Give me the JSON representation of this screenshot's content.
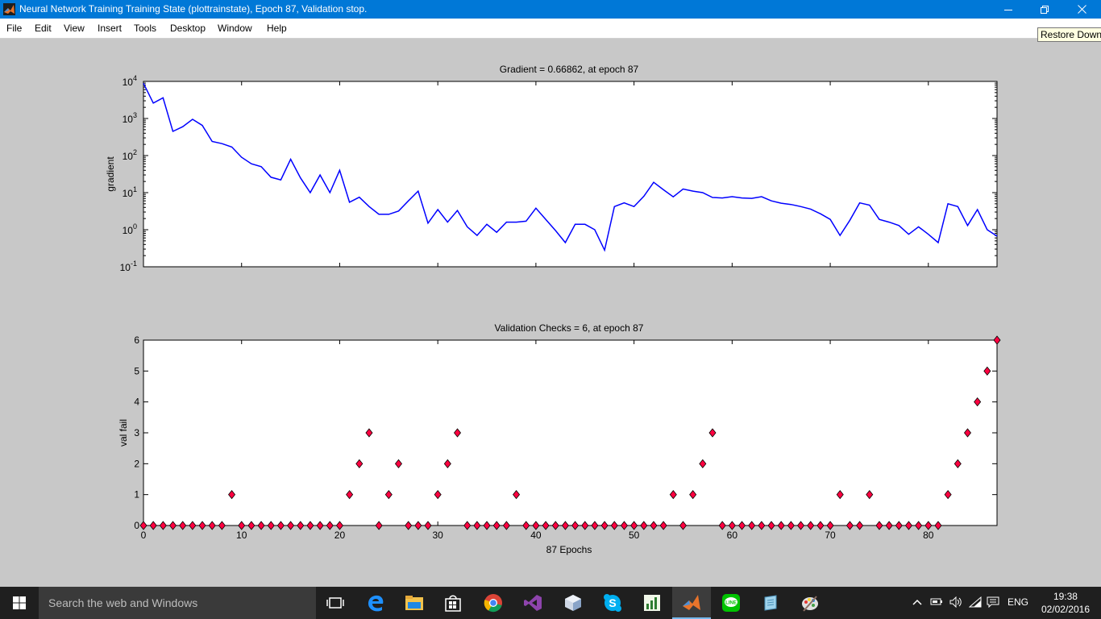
{
  "window": {
    "title": "Neural Network Training Training State (plottrainstate), Epoch 87, Validation stop.",
    "minimize_icon": "minimize-icon",
    "restore_icon": "restore-icon",
    "close_icon": "close-icon",
    "accent": "#0078d7"
  },
  "menu": [
    "File",
    "Edit",
    "View",
    "Insert",
    "Tools",
    "Desktop",
    "Window",
    "Help"
  ],
  "tooltip": "Restore Down",
  "chart_data": [
    {
      "type": "line",
      "title": "Gradient = 0.66862, at epoch 87",
      "xlabel": "",
      "ylabel": "gradient",
      "yscale": "log",
      "xlim": [
        0,
        87
      ],
      "ylim": [
        0.1,
        10000
      ],
      "x_ticks": [
        0,
        10,
        20,
        30,
        40,
        50,
        60,
        70,
        80
      ],
      "y_ticks": [
        {
          "base": "10",
          "exp": "4"
        },
        {
          "base": "10",
          "exp": "3"
        },
        {
          "base": "10",
          "exp": "2"
        },
        {
          "base": "10",
          "exp": "1"
        },
        {
          "base": "10",
          "exp": "0"
        },
        {
          "base": "10",
          "exp": "-1"
        }
      ],
      "line_color": "#0000ff",
      "series": [
        {
          "values": [
            8900,
            2600,
            3600,
            450,
            600,
            950,
            650,
            240,
            210,
            170,
            90,
            60,
            50,
            26,
            22,
            80,
            25,
            10,
            30,
            10,
            40,
            5.5,
            7.5,
            4.2,
            2.6,
            2.6,
            3.2,
            6,
            11,
            1.5,
            3.5,
            1.6,
            3.3,
            1.2,
            0.7,
            1.4,
            0.85,
            1.6,
            1.6,
            1.7,
            3.8,
            1.9,
            0.95,
            0.45,
            1.4,
            1.4,
            1.0,
            0.28,
            4.2,
            5.3,
            4.2,
            8,
            19,
            12,
            7.7,
            12.5,
            11,
            10,
            7.4,
            7.2,
            7.8,
            7.2,
            7.0,
            7.8,
            6,
            5.2,
            4.8,
            4.2,
            3.6,
            2.7,
            1.9,
            0.7,
            1.8,
            5.3,
            4.6,
            1.9,
            1.6,
            1.3,
            0.75,
            1.2,
            0.75,
            0.45,
            5,
            4.2,
            1.3,
            3.5,
            1.0,
            0.67
          ]
        }
      ]
    },
    {
      "type": "scatter",
      "title": "Validation Checks = 6, at epoch 87",
      "xlabel": "87 Epochs",
      "ylabel": "val fail",
      "xlim": [
        0,
        87
      ],
      "ylim": [
        0,
        6
      ],
      "x_ticks": [
        0,
        10,
        20,
        30,
        40,
        50,
        60,
        70,
        80
      ],
      "y_ticks": [
        0,
        1,
        2,
        3,
        4,
        5,
        6
      ],
      "marker": "diamond",
      "marker_color": "#ff0040",
      "series": [
        {
          "values": [
            0,
            0,
            0,
            0,
            0,
            0,
            0,
            0,
            0,
            1,
            0,
            0,
            0,
            0,
            0,
            0,
            0,
            0,
            0,
            0,
            0,
            1,
            2,
            3,
            0,
            1,
            2,
            0,
            0,
            0,
            1,
            2,
            3,
            0,
            0,
            0,
            0,
            0,
            1,
            0,
            0,
            0,
            0,
            0,
            0,
            0,
            0,
            0,
            0,
            0,
            0,
            0,
            0,
            0,
            1,
            0,
            1,
            2,
            3,
            0,
            0,
            0,
            0,
            0,
            0,
            0,
            0,
            0,
            0,
            0,
            0,
            1,
            0,
            0,
            1,
            0,
            0,
            0,
            0,
            0,
            0,
            0,
            1,
            2,
            3,
            4,
            5,
            6
          ]
        }
      ]
    }
  ],
  "taskbar": {
    "search_placeholder": "Search the web and Windows",
    "icons": [
      "task-view-icon",
      "edge-icon",
      "file-explorer-icon",
      "store-icon",
      "chrome-icon",
      "visual-studio-icon",
      "virtualbox-icon",
      "skype-icon",
      "project-icon",
      "matlab-icon",
      "line-icon",
      "notepad-icon",
      "paint-icon"
    ],
    "language": "ENG",
    "time": "19:38",
    "date": "02/02/2016",
    "bg": "#1f1f1f"
  }
}
